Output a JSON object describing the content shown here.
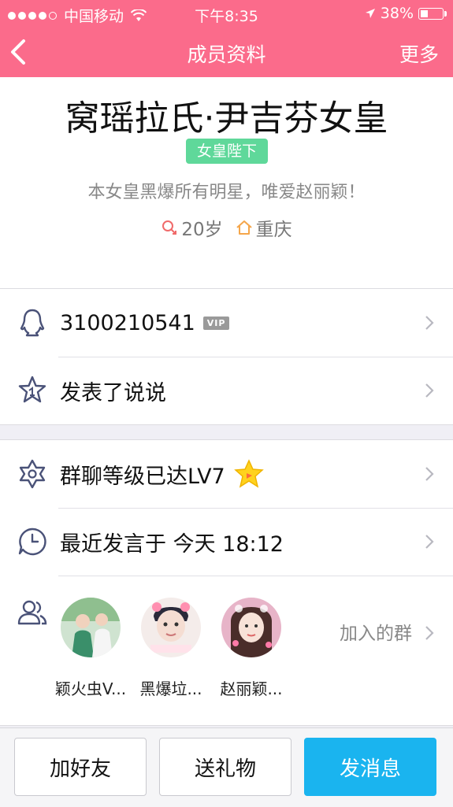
{
  "status_bar": {
    "carrier": "中国移动",
    "time": "下午8:35",
    "battery": "38%",
    "battery_level": 0.38
  },
  "nav": {
    "title": "成员资料",
    "more": "更多"
  },
  "profile": {
    "name": "窝瑶拉氏·尹吉芬女皇",
    "role": "女皇陛下",
    "signature": "本女皇黑爆所有明星，唯爱赵丽颖！",
    "age": "20岁",
    "location": "重庆"
  },
  "info_rows": [
    {
      "icon": "penguin-icon",
      "text": "3100210541",
      "badge": "VIP"
    },
    {
      "icon": "star-badge-icon",
      "text": "发表了说说"
    }
  ],
  "group_rows": [
    {
      "icon": "hexagram-icon",
      "text": "群聊等级已达LV7"
    },
    {
      "icon": "clock-icon",
      "text": "最近发言于 今天 18:12"
    }
  ],
  "joined_groups": {
    "label": "加入的群",
    "groups": [
      {
        "name": "颖火虫V...",
        "avatar_color": "#6aa37a"
      },
      {
        "name": "黑爆垃...",
        "avatar_color": "#e8d6cf"
      },
      {
        "name": "赵丽颖...",
        "avatar_color": "#d78aa8"
      }
    ]
  },
  "actions": {
    "add_friend": "加好友",
    "send_gift": "送礼物",
    "send_message": "发消息"
  },
  "colors": {
    "accent": "#fb6b8b",
    "badge_green": "#5fd89a",
    "primary_button": "#1ab4ef"
  }
}
